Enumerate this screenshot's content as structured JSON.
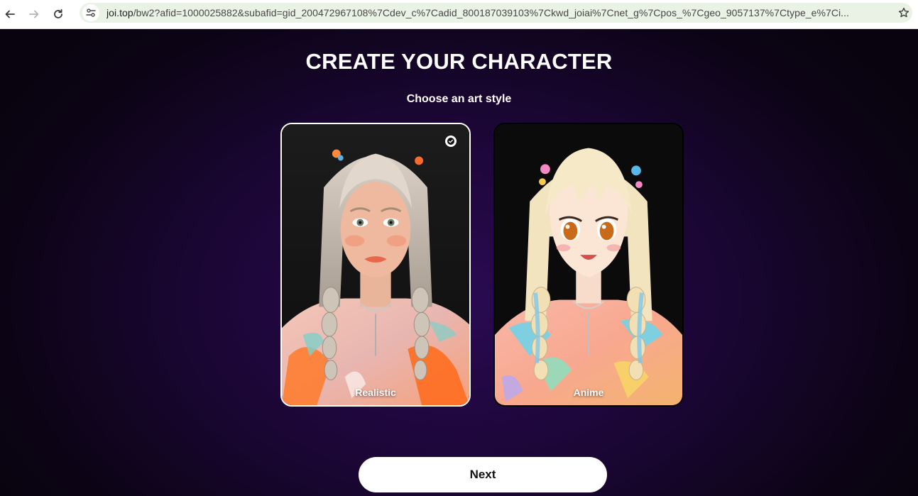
{
  "browser": {
    "url_host": "joi.top",
    "url_rest": "/bw2?afid=1000025882&subafid=gid_200472967108%7Cdev_c%7Cadid_800187039103%7Ckwd_joiai%7Cnet_g%7Cpos_%7Cgeo_9057137%7Ctype_e%7Ci..."
  },
  "page": {
    "title": "CREATE YOUR CHARACTER",
    "subtitle": "Choose an art style"
  },
  "styles": [
    {
      "label": "Realistic",
      "selected": true
    },
    {
      "label": "Anime",
      "selected": false
    }
  ],
  "actions": {
    "next_label": "Next"
  },
  "colors": {
    "accent_selected_border": "#ffffff",
    "background_center": "#2a0a52",
    "background_edge": "#08030e"
  },
  "icons": [
    "back-arrow-icon",
    "forward-arrow-icon",
    "reload-icon",
    "site-info-icon",
    "bookmark-star-icon",
    "check-icon"
  ]
}
